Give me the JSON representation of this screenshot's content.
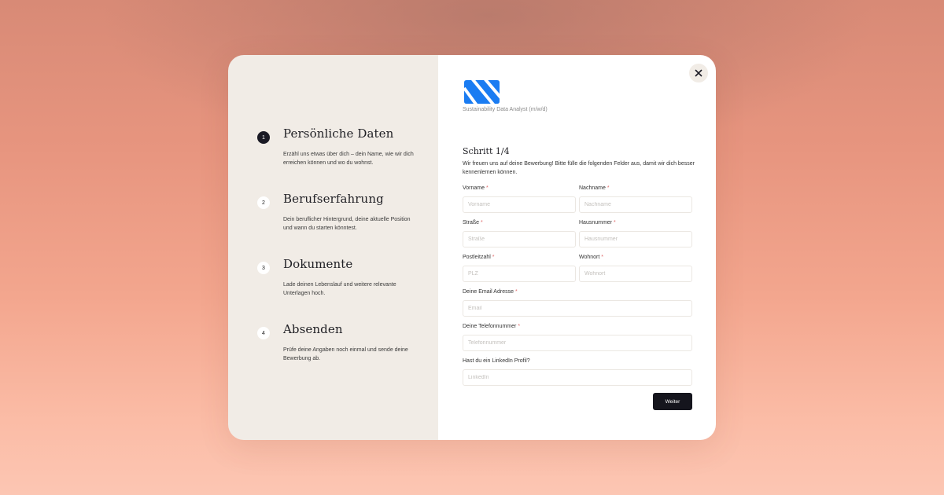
{
  "colors": {
    "accent": "#1a7cf2",
    "dark": "#15151d",
    "panel": "#f1ece6"
  },
  "steps": [
    {
      "number": "1",
      "title": "Persönliche Daten",
      "desc": "Erzähl uns etwas über dich – dein Name, wie wir dich erreichen können und wo du wohnst."
    },
    {
      "number": "2",
      "title": "Berufserfahrung",
      "desc": "Dein beruflicher Hintergrund, deine aktuelle Position und wann du starten könntest."
    },
    {
      "number": "3",
      "title": "Dokumente",
      "desc": "Lade deinen Lebenslauf und weitere relevante Unterlagen hoch."
    },
    {
      "number": "4",
      "title": "Absenden",
      "desc": "Prüfe deine Angaben noch einmal und sende deine Bewerbung ab."
    }
  ],
  "header": {
    "close_icon": "close-icon",
    "logo": "company-logo",
    "job_title": "Sustainability Data Analyst (m/w/d)"
  },
  "form": {
    "heading": "Schritt 1/4",
    "intro": "Wir freuen uns auf deine Bewerbung! Bitte fülle die folgenden Felder aus, damit wir dich besser kennenlernen können.",
    "fields": {
      "vorname": {
        "label": "Vorname",
        "placeholder": "Vorname",
        "required": "*"
      },
      "nachname": {
        "label": "Nachname",
        "placeholder": "Nachname",
        "required": "*"
      },
      "strasse": {
        "label": "Straße",
        "placeholder": "Straße",
        "required": "*"
      },
      "hausnummer": {
        "label": "Hausnummer",
        "placeholder": "Hausnummer",
        "required": "*"
      },
      "plz": {
        "label": "Postleitzahl",
        "placeholder": "PLZ",
        "required": "*"
      },
      "wohnort": {
        "label": "Wohnort",
        "placeholder": "Wohnort",
        "required": "*"
      },
      "email": {
        "label": "Deine Email Adresse",
        "placeholder": "Email",
        "required": "*"
      },
      "telefon": {
        "label": "Deine Telefonnummer",
        "placeholder": "Telefonnummer",
        "required": "*"
      },
      "linkedin": {
        "label": "Hast du ein LinkedIn Profil?",
        "placeholder": "LinkedIn",
        "required": ""
      }
    },
    "submit_label": "Weiter"
  }
}
